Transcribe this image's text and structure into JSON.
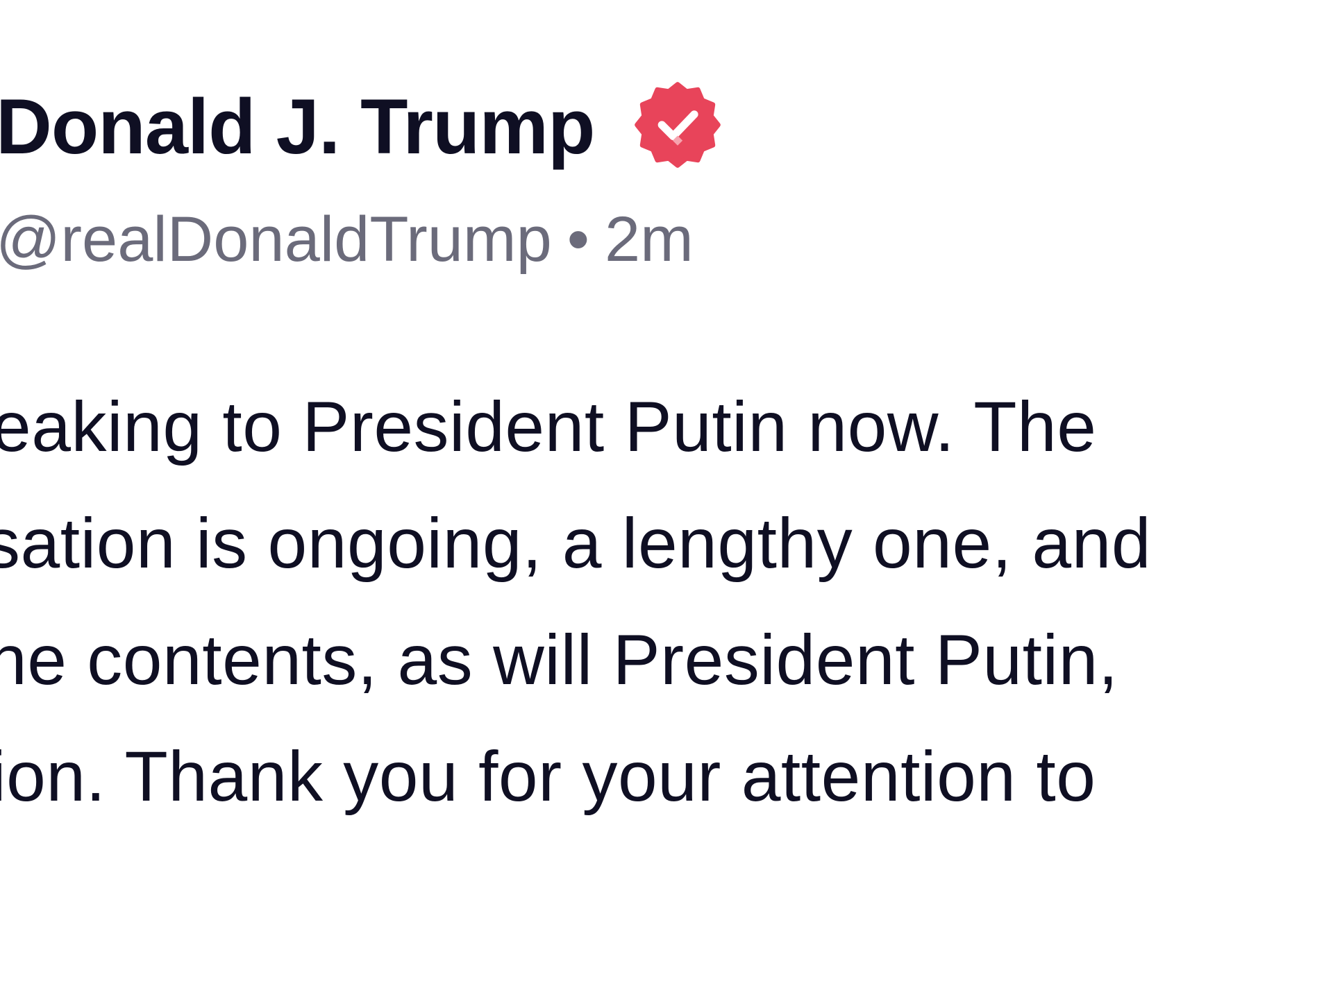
{
  "post": {
    "author_name": "Donald J. Trump",
    "handle": "@realDonaldTrump",
    "separator": "•",
    "time_ago": "2m",
    "verified_icon": "verified-badge-icon",
    "lines": [
      "eaking to President Putin now. The",
      "sation is ongoing, a lengthy one, and",
      "he contents, as will President Putin,",
      "ion. Thank you for your attention to"
    ]
  },
  "colors": {
    "background": "#ffffff",
    "text_primary": "#0f0f23",
    "text_secondary": "#6b6b7b",
    "badge": "#e8445a"
  }
}
